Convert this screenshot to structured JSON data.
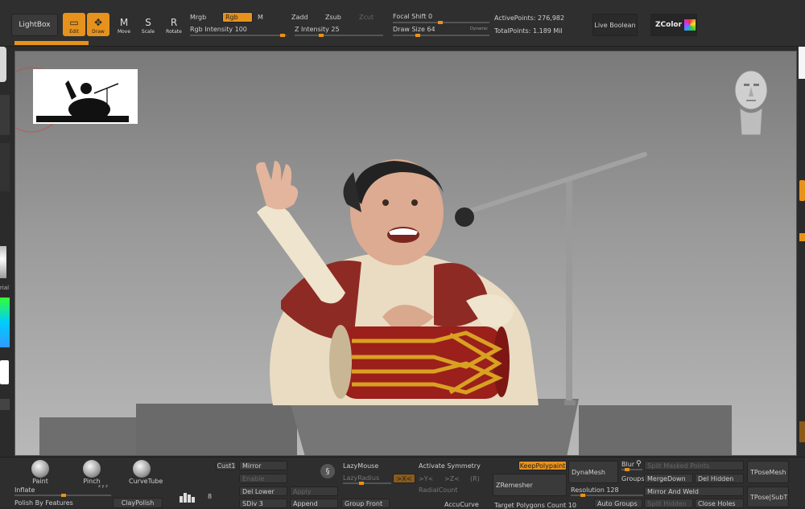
{
  "top": {
    "lightbox": "LightBox",
    "tools": [
      {
        "label": "Edit",
        "icon": "edit-icon",
        "glyph": "▭",
        "active": true
      },
      {
        "label": "Draw",
        "icon": "draw-icon",
        "glyph": "✥",
        "active": true
      },
      {
        "label": "Move",
        "icon": "move-icon",
        "glyph": "M",
        "active": false
      },
      {
        "label": "Scale",
        "icon": "scale-icon",
        "glyph": "S",
        "active": false
      },
      {
        "label": "Rotate",
        "icon": "rotate-icon",
        "glyph": "R",
        "active": false
      }
    ],
    "mrgb": "Mrgb",
    "rgb": "Rgb",
    "m": "M",
    "rgb_intensity_label": "Rgb Intensity",
    "rgb_intensity_value": "100",
    "zadd": "Zadd",
    "zsub": "Zsub",
    "zcut": "Zcut",
    "z_intensity_label": "Z Intensity",
    "z_intensity_value": "25",
    "focal_shift_label": "Focal Shift",
    "focal_shift_value": "0",
    "draw_size_label": "Draw Size",
    "draw_size_value": "64",
    "dynamic": "Dynamic",
    "active_points_label": "ActivePoints:",
    "active_points_value": "276,982",
    "total_points_label": "TotalPoints:",
    "total_points_value": "1.189 Mil",
    "live_boolean": "Live Boolean",
    "zcolor": "ZColor"
  },
  "left": {
    "partial_label": "rial"
  },
  "bottom": {
    "brushes": [
      {
        "label": "Paint",
        "icon": "paint-brush-icon"
      },
      {
        "label": "Pinch",
        "icon": "pinch-brush-icon"
      },
      {
        "label": "CurveTube",
        "icon": "curvetube-brush-icon"
      }
    ],
    "inflate": "Inflate",
    "inflate_axes": "x y z",
    "polish_by_features": "Polish By Features",
    "claypolish": "ClayPolish",
    "count": "8",
    "cust1": "Cust1",
    "mirror": "Mirror",
    "enable": "Enable",
    "del_lower": "Del Lower",
    "apply": "Apply",
    "sdiv": "SDiv 3",
    "append": "Append",
    "lazymouse": "LazyMouse",
    "lazyradius": "LazyRadius",
    "group_front": "Group Front",
    "activate_symmetry": "Activate Symmetry",
    "sym_x": ">X<",
    "sym_y": ">Y<",
    "sym_z": ">Z<",
    "sym_r": "(R)",
    "radial_count": "RadialCount",
    "accucurve": "AccuCurve",
    "keep_polypaint": "KeepPolypaint",
    "zremesher": "ZRemesher",
    "target_polygons": "Target Polygons Count 10",
    "dynamesh": "DynaMesh",
    "resolution": "Resolution 128",
    "auto_groups": "Auto Groups",
    "blur": "Blur",
    "groups": "Groups",
    "split_masked_points": "Split Masked Points",
    "merge_down": "MergeDown",
    "del_hidden": "Del Hidden",
    "mirror_and_weld": "Mirror And Weld",
    "split_hidden": "Split Hidden",
    "close_holes": "Close Holes",
    "tposemesh": "TPoseMesh",
    "tpose_subt": "TPose|SubT"
  }
}
